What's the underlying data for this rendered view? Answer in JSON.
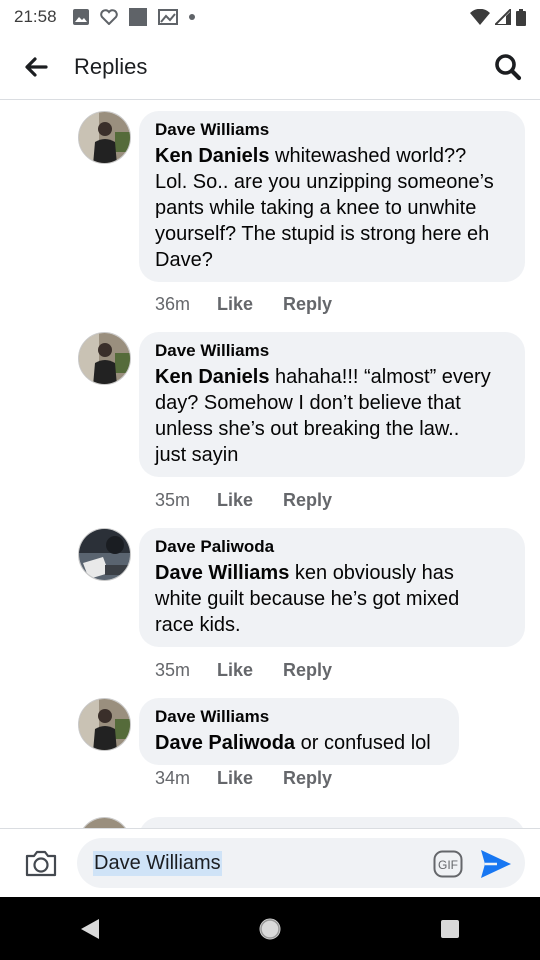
{
  "status_bar": {
    "time": "21:58"
  },
  "header": {
    "title": "Replies",
    "back_icon": "arrow-left-icon",
    "search_icon": "search-icon"
  },
  "comments": [
    {
      "author": "Dave Williams",
      "mention": "Ken Daniels",
      "lines": [
        " whitewashed world??",
        "Lol. So.. are you unzipping someone’s",
        "pants while taking a knee to unwhite",
        "yourself? The stupid is strong here eh",
        "Dave?"
      ],
      "time": "36m",
      "like": "Like",
      "reply": "Reply"
    },
    {
      "author": "Dave Williams",
      "mention": "Ken Daniels",
      "lines": [
        " hahaha!!! “almost” every",
        "day? Somehow I don’t believe that",
        "unless she’s out breaking the law..",
        "just sayin"
      ],
      "time": "35m",
      "like": "Like",
      "reply": "Reply"
    },
    {
      "author": "Dave Paliwoda",
      "mention": "Dave Williams",
      "lines": [
        " ken obviously has",
        "white guilt because he’s got mixed",
        "race kids."
      ],
      "time": "35m",
      "like": "Like",
      "reply": "Reply"
    },
    {
      "author": "Dave Williams",
      "mention": "Dave Paliwoda",
      "lines": [
        " or confused lol"
      ],
      "time": "34m",
      "like": "Like",
      "reply": "Reply"
    }
  ],
  "composer": {
    "value": "Dave Williams",
    "camera_icon": "camera-icon",
    "gif_label": "GIF",
    "send_icon": "send-icon"
  },
  "colors": {
    "accent": "#1877f2",
    "bubble": "#f0f2f5",
    "meta": "#65676b"
  }
}
